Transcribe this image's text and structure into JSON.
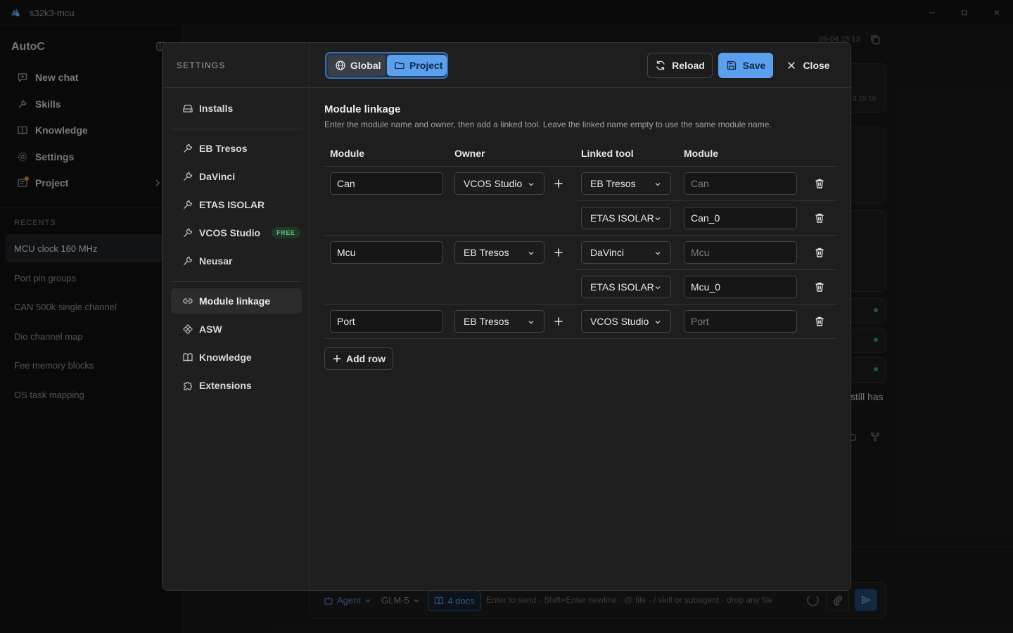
{
  "window": {
    "title": "s32k3-mcu"
  },
  "sidebar": {
    "brand": "AutoC",
    "nav": [
      {
        "label": "New chat",
        "icon": "new-chat-icon"
      },
      {
        "label": "Skills",
        "icon": "skills-icon"
      },
      {
        "label": "Knowledge",
        "icon": "book-icon"
      },
      {
        "label": "Settings",
        "icon": "gear-icon"
      },
      {
        "label": "Project",
        "icon": "project-icon"
      }
    ],
    "recents_label": "RECENTS",
    "recents": [
      "MCU clock 160 MHz",
      "Port pin groups",
      "CAN 500k single channel",
      "Dio channel map",
      "Fee memory blocks",
      "OS task mapping"
    ]
  },
  "background": {
    "timestamp": "09-04 15:13",
    "card_time": "3 15:16",
    "snippet": "still has"
  },
  "composer": {
    "agent": "Agent",
    "model": "GLM-5",
    "docs": "4 docs",
    "placeholder": "Enter to send · Shift+Enter newline · @ file · / skill or subagent · drop any file"
  },
  "settings": {
    "heading": "SETTINGS",
    "scope": {
      "global": "Global",
      "project": "Project",
      "active": "Project"
    },
    "buttons": {
      "reload": "Reload",
      "save": "Save",
      "close": "Close"
    },
    "nav": {
      "installs": "Installs",
      "tools": [
        {
          "label": "EB Tresos"
        },
        {
          "label": "DaVinci"
        },
        {
          "label": "ETAS ISOLAR"
        },
        {
          "label": "VCOS Studio",
          "badge": "FREE"
        },
        {
          "label": "Neusar"
        }
      ],
      "module_linkage": "Module linkage",
      "asw": "ASW",
      "knowledge": "Knowledge",
      "extensions": "Extensions"
    },
    "section": {
      "title": "Module linkage",
      "description": "Enter the module name and owner, then add a linked tool. Leave the linked name empty to use the same module name.",
      "columns": {
        "module": "Module",
        "owner": "Owner",
        "linked_tool": "Linked tool",
        "linked_module": "Module"
      },
      "rows": [
        {
          "module": "Can",
          "owner": "VCOS Studio",
          "links": [
            {
              "tool": "EB Tresos",
              "name": "",
              "placeholder": "Can"
            },
            {
              "tool": "ETAS ISOLAR",
              "name": "Can_0",
              "placeholder": ""
            }
          ]
        },
        {
          "module": "Mcu",
          "owner": "EB Tresos",
          "links": [
            {
              "tool": "DaVinci",
              "name": "",
              "placeholder": "Mcu"
            },
            {
              "tool": "ETAS ISOLAR",
              "name": "Mcu_0",
              "placeholder": ""
            }
          ]
        },
        {
          "module": "Port",
          "owner": "EB Tresos",
          "links": [
            {
              "tool": "VCOS Studio",
              "name": "",
              "placeholder": "Port"
            }
          ]
        }
      ],
      "add_row": "Add row"
    }
  },
  "colors": {
    "accent": "#5aa0ec",
    "free_badge": "#5fbf78",
    "status_dot": "#3b8a4c",
    "project_dot": "#e0832e"
  }
}
